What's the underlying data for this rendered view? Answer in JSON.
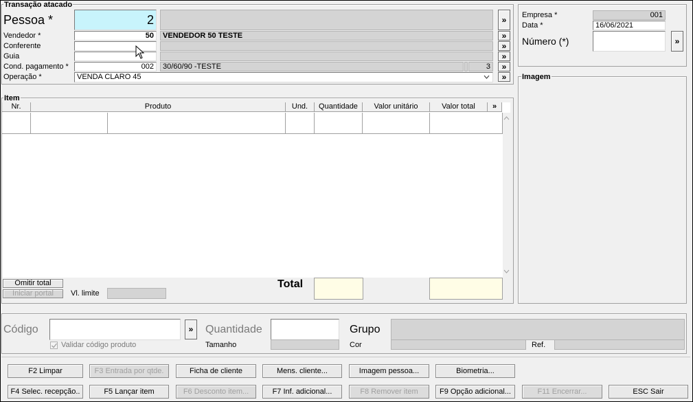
{
  "transacao": {
    "title": "Transação atacado",
    "pessoa": {
      "label": "Pessoa *",
      "value": "2"
    },
    "vendedor": {
      "label": "Vendedor *",
      "code": "50",
      "name": "VENDEDOR 50 TESTE"
    },
    "conferente": {
      "label": "Conferente",
      "code": "",
      "name": ""
    },
    "guia": {
      "label": "Guia",
      "code": "",
      "name": ""
    },
    "cond_pagamento": {
      "label": "Cond. pagamento *",
      "code": "002",
      "name": "30/60/90 -TESTE",
      "parcelas": "3"
    },
    "operacao": {
      "label": "Operação *",
      "value": "VENDA CLARO 45"
    },
    "more_glyph": "»"
  },
  "empresa": {
    "empresa_label": "Empresa *",
    "empresa_value": "001",
    "data_label": "Data *",
    "data_value": "16/06/2021",
    "numero_label": "Número (*)",
    "numero_value": ""
  },
  "imagem": {
    "title": "Imagem"
  },
  "item": {
    "title": "Item",
    "columns": [
      "Nr.",
      "Produto",
      "Und.",
      "Quantidade",
      "Valor unitário",
      "Valor total",
      "»"
    ],
    "omitir_total": "Omitir total",
    "iniciar_portal": "Iniciar portal",
    "vl_limite_label": "Vl. limite",
    "total_label": "Total"
  },
  "entrada": {
    "codigo_label": "Código",
    "quantidade_label": "Quantidade",
    "grupo_label": "Grupo",
    "validar_label": "Validar código produto",
    "tamanho_label": "Tamanho",
    "cor_label": "Cor",
    "ref_label": "Ref."
  },
  "buttons": {
    "row1": [
      "F2 Limpar",
      "F3 Entrada por qtde.",
      "Ficha de cliente",
      "Mens. cliente...",
      "Imagem pessoa...",
      "Biometria..."
    ],
    "row2": [
      "F4 Selec. recepção..",
      "F5 Lançar item",
      "F6 Desconto item...",
      "F7 Inf. adicional...",
      "F8 Remover item",
      "F9 Opção adicional...",
      "F11 Encerrar...",
      "ESC Sair"
    ]
  },
  "colors": {
    "pessoa_bg": "#c8f4fc",
    "total_bg": "#fffde6",
    "window_bg": "#f0f0f0"
  }
}
